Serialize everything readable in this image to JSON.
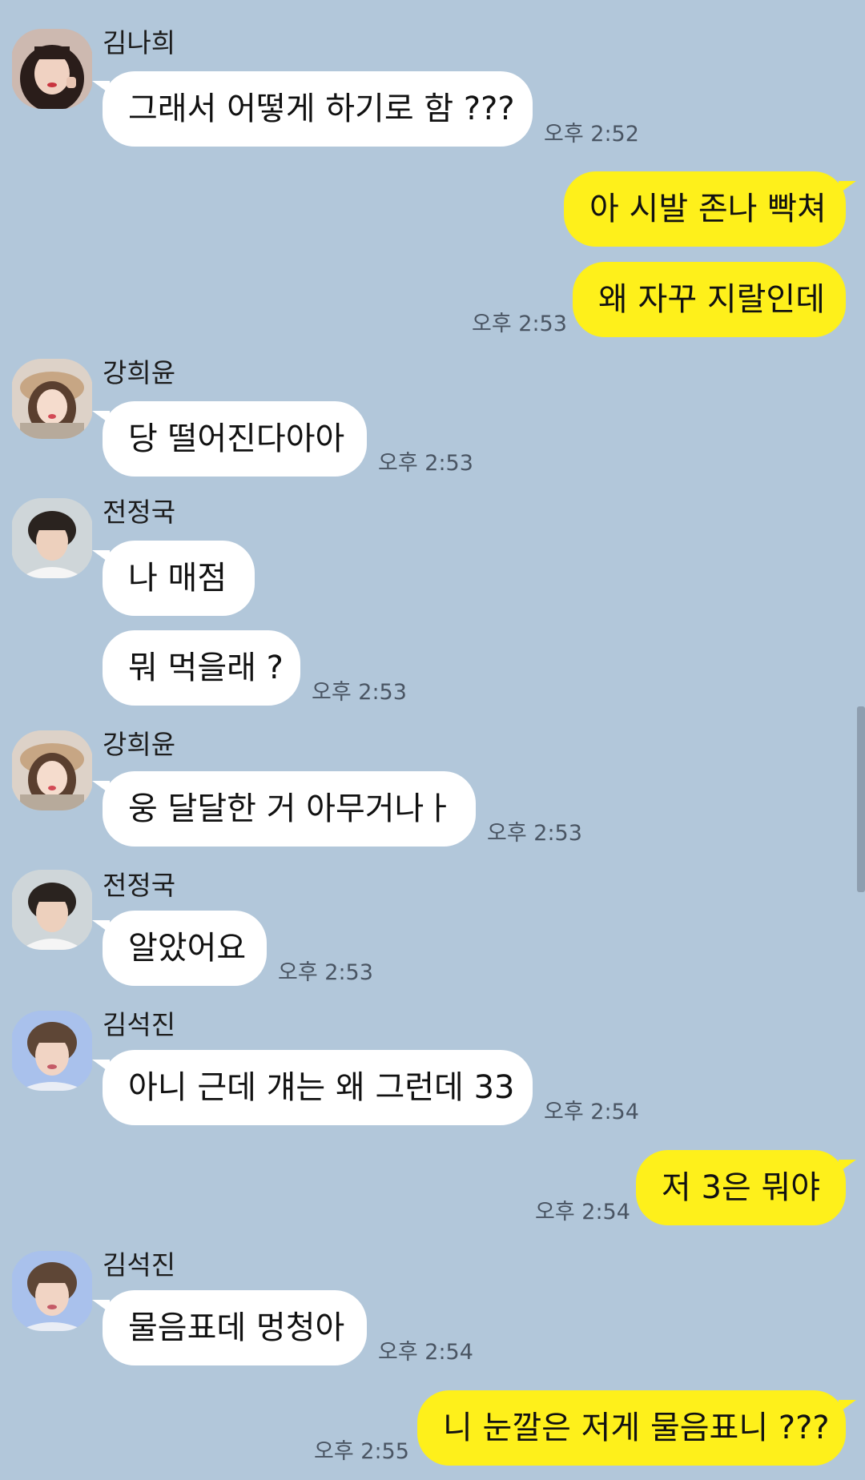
{
  "colors": {
    "background": "#b2c7da",
    "incoming_bubble": "#ffffff",
    "outgoing_bubble": "#fef01b",
    "time_text": "#4a5563"
  },
  "messages": [
    {
      "sender": "김나희",
      "text": "그래서 어떻게 하기로 함 ???",
      "time": "오후 2:52",
      "avatar": "avatar-kim-nahee"
    },
    {
      "text": "아 시발 존나 빡쳐"
    },
    {
      "text": "왜 자꾸 지랄인데",
      "time": "오후 2:53"
    },
    {
      "sender": "강희윤",
      "text": "당 떨어진다아아",
      "time": "오후 2:53",
      "avatar": "avatar-kang-heeyun"
    },
    {
      "sender": "전정국",
      "text": "나 매점",
      "avatar": "avatar-jeon-jungkook"
    },
    {
      "text": "뭐 먹을래 ?",
      "time": "오후 2:53"
    },
    {
      "sender": "강희윤",
      "text": "웅 달달한 거 아무거나ㅏ",
      "time": "오후 2:53",
      "avatar": "avatar-kang-heeyun"
    },
    {
      "sender": "전정국",
      "text": "알았어요",
      "time": "오후 2:53",
      "avatar": "avatar-jeon-jungkook"
    },
    {
      "sender": "김석진",
      "text": "아니 근데 걔는 왜 그런데 33",
      "time": "오후 2:54",
      "avatar": "avatar-kim-seokjin"
    },
    {
      "text": "저 3은 뭐야",
      "time": "오후 2:54"
    },
    {
      "sender": "김석진",
      "text": "물음표데 멍청아",
      "time": "오후 2:54",
      "avatar": "avatar-kim-seokjin"
    },
    {
      "text": "니 눈깔은 저게 물음표니 ???",
      "time": "오후 2:55"
    }
  ]
}
